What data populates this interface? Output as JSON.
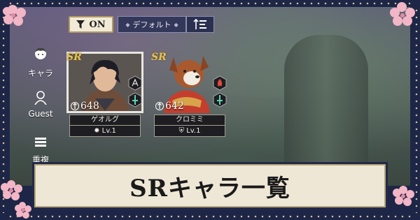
{
  "filter": {
    "state_label": "ON"
  },
  "sort": {
    "label": "デフォルト"
  },
  "side_nav": {
    "items": [
      {
        "label": "キャラ"
      },
      {
        "label": "Guest"
      },
      {
        "label": "重複"
      }
    ]
  },
  "cards": [
    {
      "rarity": "SR",
      "power": "648",
      "name": "ゲオルグ",
      "level": "Lv.1"
    },
    {
      "rarity": "SR",
      "power": "642",
      "name": "クロミミ",
      "level": "Lv.1"
    }
  ],
  "banner": {
    "title": "SRキャラ一覧"
  },
  "colors": {
    "frame": "#1d2646",
    "banner_bg": "#efe7d6",
    "rarity_gold": "#e2c35a",
    "sakura": "#f2b6c6"
  }
}
